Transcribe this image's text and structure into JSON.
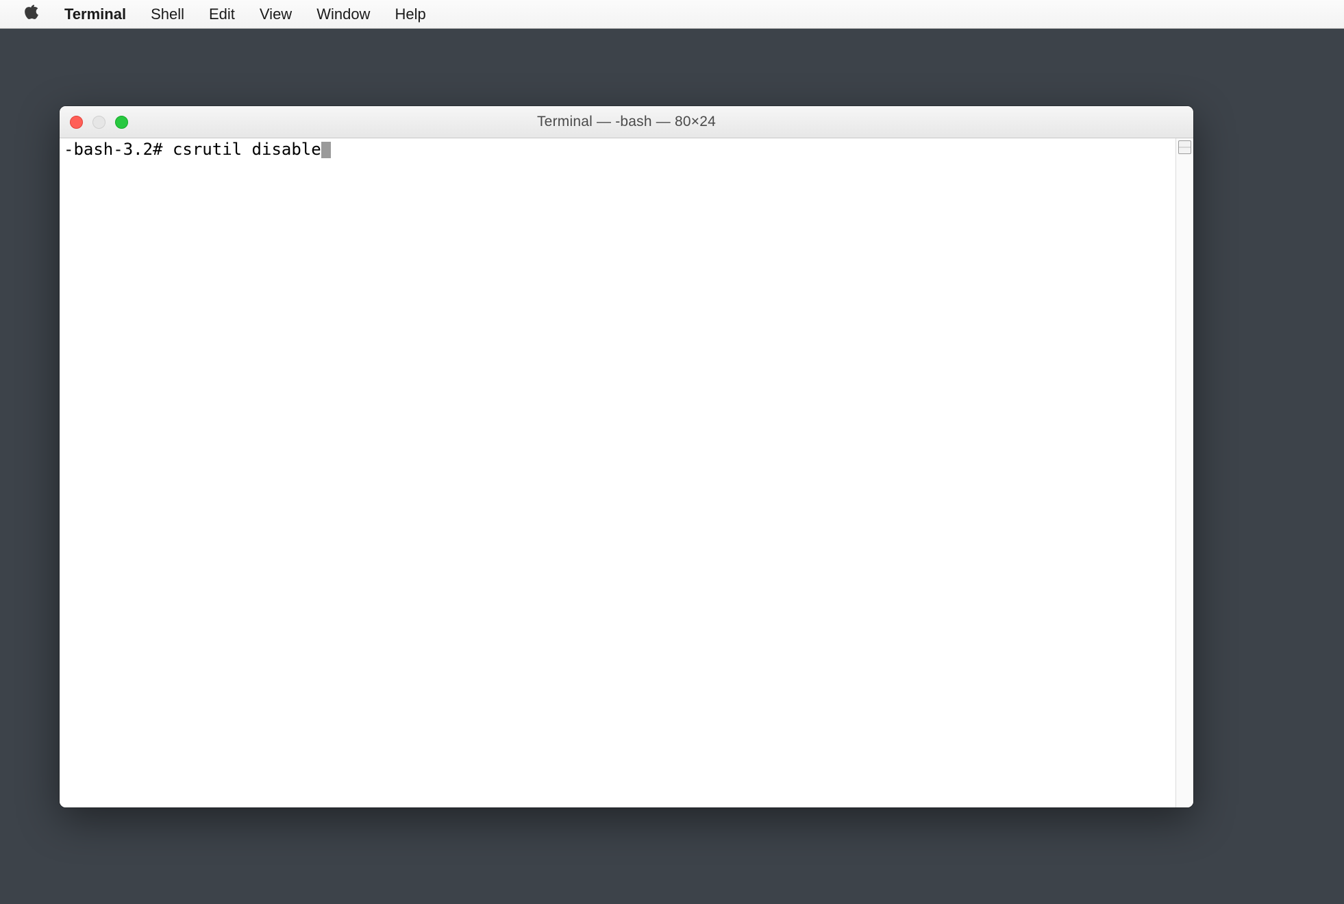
{
  "menubar": {
    "app_name": "Terminal",
    "items": [
      "Shell",
      "Edit",
      "View",
      "Window",
      "Help"
    ]
  },
  "window": {
    "title": "Terminal — -bash — 80×24",
    "traffic_lights": {
      "close": "red",
      "minimize": "inactive",
      "zoom": "green"
    }
  },
  "terminal": {
    "prompt": "-bash-3.2# ",
    "command": "csrutil disable"
  }
}
